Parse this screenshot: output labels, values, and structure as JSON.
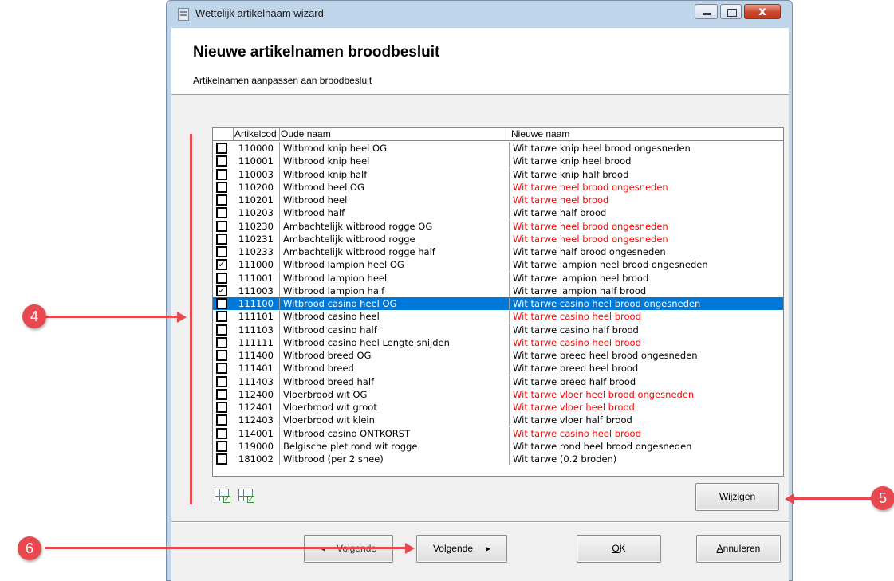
{
  "window": {
    "title": "Wettelijk artikelnaam wizard",
    "close_glyph": "x"
  },
  "header": {
    "title": "Nieuwe artikelnamen broodbesluit",
    "subtitle": "Artikelnamen aanpassen aan broodbesluit"
  },
  "grid": {
    "columns": [
      "Artikelcode",
      "Oude naam",
      "Nieuwe naam"
    ],
    "header_code_visible": "Artikelcod",
    "selected_row_index": 12,
    "rows": [
      {
        "checked": false,
        "code": "110000",
        "old": "Witbrood knip heel OG",
        "new": "Wit tarwe knip heel brood ongesneden",
        "new_red": false
      },
      {
        "checked": false,
        "code": "110001",
        "old": "Witbrood knip heel",
        "new": "Wit tarwe knip heel brood",
        "new_red": false
      },
      {
        "checked": false,
        "code": "110003",
        "old": "Witbrood knip half",
        "new": "Wit tarwe knip half brood",
        "new_red": false
      },
      {
        "checked": false,
        "code": "110200",
        "old": "Witbrood heel OG",
        "new": "Wit tarwe heel brood ongesneden",
        "new_red": true
      },
      {
        "checked": false,
        "code": "110201",
        "old": "Witbrood heel",
        "new": "Wit tarwe heel brood",
        "new_red": true
      },
      {
        "checked": false,
        "code": "110203",
        "old": "Witbrood half",
        "new": "Wit tarwe half brood",
        "new_red": false
      },
      {
        "checked": false,
        "code": "110230",
        "old": "Ambachtelijk witbrood rogge OG",
        "new": "Wit tarwe heel brood ongesneden",
        "new_red": true
      },
      {
        "checked": false,
        "code": "110231",
        "old": "Ambachtelijk witbrood rogge",
        "new": "Wit tarwe heel brood ongesneden",
        "new_red": true
      },
      {
        "checked": false,
        "code": "110233",
        "old": "Ambachtelijk witbrood rogge half",
        "new": "Wit tarwe half brood ongesneden",
        "new_red": false
      },
      {
        "checked": true,
        "code": "111000",
        "old": "Witbrood lampion heel OG",
        "new": "Wit tarwe lampion heel brood ongesneden",
        "new_red": false
      },
      {
        "checked": false,
        "code": "111001",
        "old": "Witbrood lampion heel",
        "new": "Wit tarwe lampion heel brood",
        "new_red": false
      },
      {
        "checked": true,
        "code": "111003",
        "old": "Witbrood lampion half",
        "new": "Wit tarwe lampion half brood",
        "new_red": false
      },
      {
        "checked": true,
        "code": "111100",
        "old": "Witbrood casino heel OG",
        "new": "Wit tarwe casino heel brood ongesneden",
        "new_red": false
      },
      {
        "checked": false,
        "code": "111101",
        "old": "Witbrood casino heel",
        "new": "Wit tarwe casino heel brood",
        "new_red": true
      },
      {
        "checked": false,
        "code": "111103",
        "old": "Witbrood casino half",
        "new": "Wit tarwe casino half brood",
        "new_red": false
      },
      {
        "checked": false,
        "code": "111111",
        "old": "Witbrood casino heel Lengte snijden",
        "new": "Wit tarwe casino heel brood",
        "new_red": true
      },
      {
        "checked": false,
        "code": "111400",
        "old": "Witbrood breed OG",
        "new": "Wit tarwe breed heel brood ongesneden",
        "new_red": false
      },
      {
        "checked": false,
        "code": "111401",
        "old": "Witbrood breed",
        "new": "Wit tarwe breed heel brood",
        "new_red": false
      },
      {
        "checked": false,
        "code": "111403",
        "old": "Witbrood breed half",
        "new": "Wit tarwe breed half brood",
        "new_red": false
      },
      {
        "checked": false,
        "code": "112400",
        "old": "Vloerbrood wit OG",
        "new": "Wit tarwe vloer heel brood ongesneden",
        "new_red": true
      },
      {
        "checked": false,
        "code": "112401",
        "old": "Vloerbrood wit groot",
        "new": "Wit tarwe vloer heel brood",
        "new_red": true
      },
      {
        "checked": false,
        "code": "112403",
        "old": "Vloerbrood wit klein",
        "new": "Wit tarwe vloer half brood",
        "new_red": false
      },
      {
        "checked": false,
        "code": "114001",
        "old": "Witbrood casino ONTKORST",
        "new": "Wit tarwe casino heel brood",
        "new_red": true
      },
      {
        "checked": false,
        "code": "119000",
        "old": "Belgische plet rond wit rogge",
        "new": "Wit tarwe rond heel brood ongesneden",
        "new_red": false
      },
      {
        "checked": false,
        "code": "181002",
        "old": "Witbrood (per 2 snee)",
        "new": "Wit tarwe (0.2 broden)",
        "new_red": false
      }
    ],
    "tool_icons": [
      "select-all-icon",
      "deselect-all-icon"
    ]
  },
  "buttons": {
    "wijzigen": {
      "pre": "",
      "u": "W",
      "post": "ijzigen"
    },
    "vorige": {
      "arrow": "◂",
      "label": "Volgende"
    },
    "volgende": {
      "label": "Volgende",
      "arrow": "▸"
    },
    "ok": {
      "u": "O",
      "post": "K"
    },
    "annuleren": {
      "u": "A",
      "post": "nnuleren"
    }
  },
  "annotations": {
    "callout_4": "4",
    "callout_5": "5",
    "callout_6": "6",
    "color": "#e8484f"
  },
  "colors": {
    "selection": "#0078d7",
    "changed_name": "#ff0000"
  }
}
